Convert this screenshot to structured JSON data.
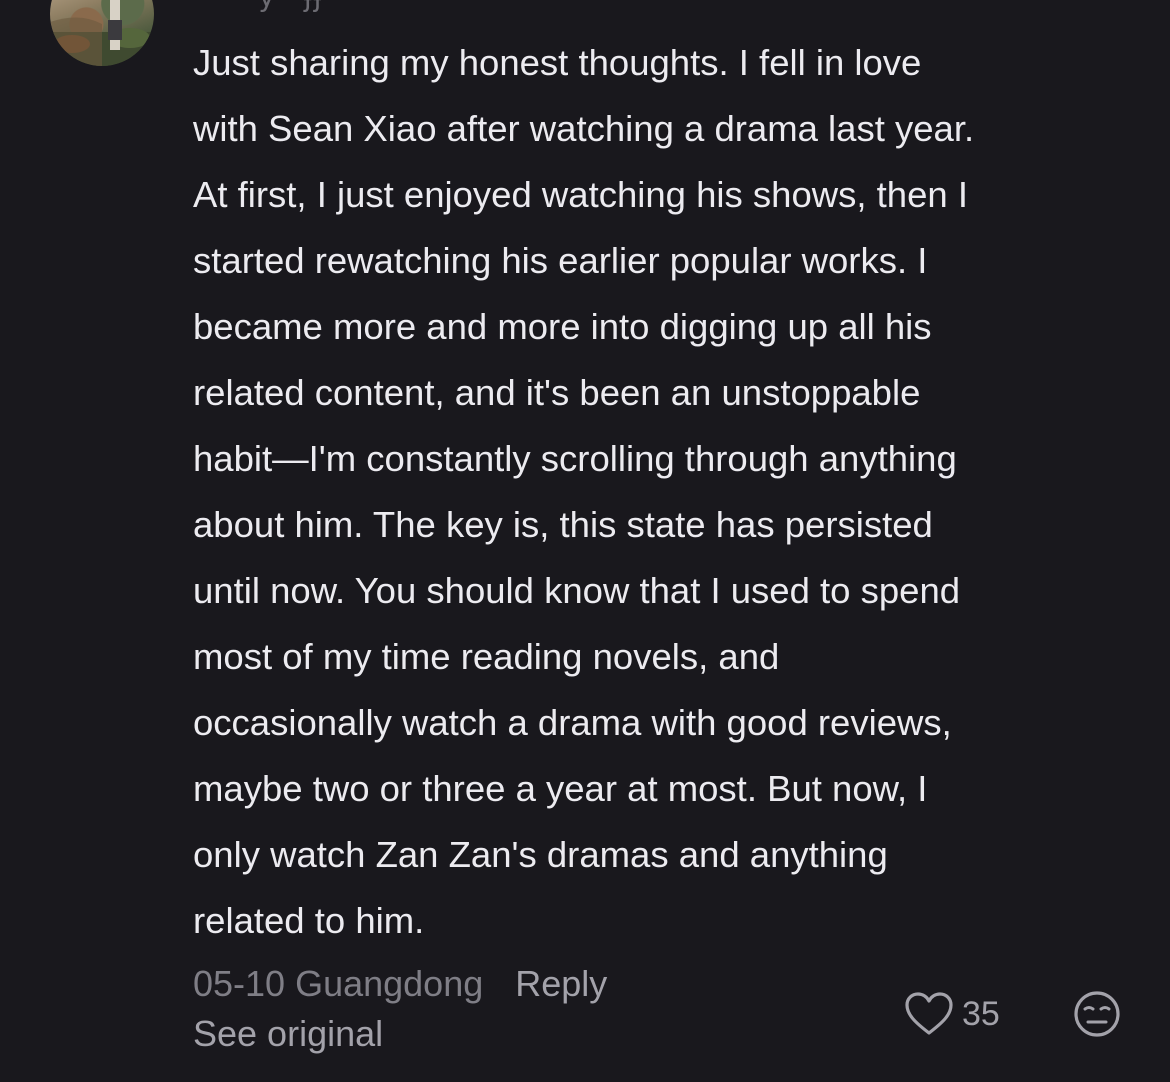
{
  "comment": {
    "username": "· · · y ˙ɉɉ",
    "body_lines": [
      "Just sharing my honest thoughts. I fell in love",
      "with Sean Xiao after watching a drama last year.",
      "At first, I just enjoyed watching his shows, then I",
      "started rewatching his earlier popular works. I",
      "became more and more into digging up all his",
      "related content, and it's been an unstoppable",
      "habit—I'm constantly scrolling through anything",
      "about him. The key is, this state has persisted",
      "until now. You should know that I used to spend",
      "most of my time reading novels, and",
      "occasionally watch a drama with good reviews,",
      "maybe two or three a year at most. But now, I",
      "only watch Zan Zan's dramas and anything",
      "related to him."
    ],
    "date": "05-10",
    "location": "Guangdong",
    "date_location": "05-10 Guangdong",
    "reply_label": "Reply",
    "see_original_label": "See original",
    "like_count": "35",
    "like_icon": "heart-outline-icon",
    "dislike_icon": "unamused-face-icon"
  },
  "colors": {
    "background": "#19181d",
    "primary_text": "#ecebf0",
    "secondary_text": "#7f7e86",
    "action_text": "#a3a2aa"
  }
}
